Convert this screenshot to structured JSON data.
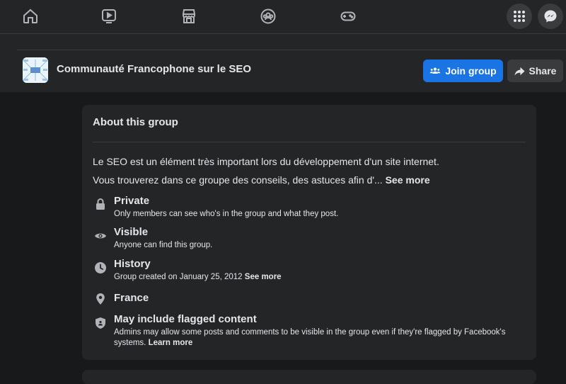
{
  "group": {
    "name": "Communauté Francophone sur le SEO",
    "join_label": "Join group",
    "share_label": "Share"
  },
  "about": {
    "title": "About this group",
    "description_line1": "Le SEO est un élément très important lors du développement d'un site internet.",
    "description_line2": "Vous trouverez dans ce groupe des conseils, des astuces afin d'...",
    "see_more": "See more",
    "items": [
      {
        "icon": "lock-icon",
        "title": "Private",
        "subtitle": "Only members can see who's in the group and what they post."
      },
      {
        "icon": "eye-icon",
        "title": "Visible",
        "subtitle": "Anyone can find this group."
      },
      {
        "icon": "clock-icon",
        "title": "History",
        "subtitle": "Group created on January 25, 2012",
        "link": "See more"
      },
      {
        "icon": "location-pin-icon",
        "title": "France"
      },
      {
        "icon": "shield-icon",
        "title": "May include flagged content",
        "subtitle": "Admins may allow some posts and comments to be visible in the group even if they're flagged by Facebook's systems.",
        "link": "Learn more"
      }
    ]
  },
  "colors": {
    "background": "#18191a",
    "surface": "#242526",
    "accent": "#1b74e4",
    "text": "#e4e6eb"
  }
}
